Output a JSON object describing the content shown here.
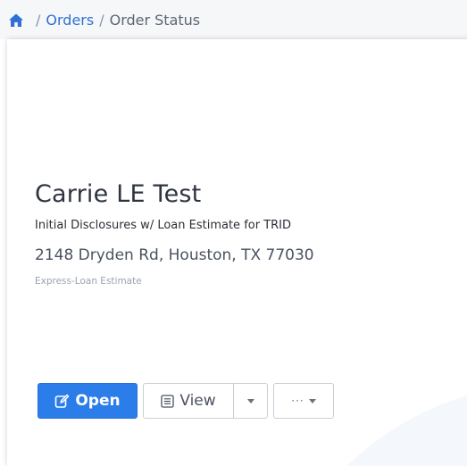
{
  "breadcrumb": {
    "home_icon": "home-icon",
    "separator": "/",
    "items": [
      {
        "label": "Orders"
      },
      {
        "label": "Order Status"
      }
    ]
  },
  "order": {
    "title": "Carrie LE Test",
    "subtitle": "Initial Disclosures w/ Loan Estimate for TRID",
    "address": "2148 Dryden Rd, Houston, TX 77030",
    "product": "Express-Loan Estimate"
  },
  "actions": {
    "open_label": "Open",
    "open_icon": "edit-icon",
    "view_label": "View",
    "view_icon": "list-icon",
    "view_dropdown_icon": "caret-down-icon",
    "more_label": "···",
    "more_icon": "caret-down-icon"
  },
  "colors": {
    "accent": "#2b7de9",
    "link": "#2f6fd6"
  }
}
